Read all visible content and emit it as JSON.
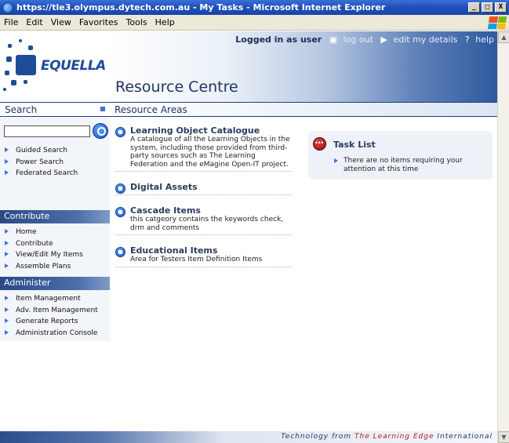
{
  "window": {
    "title": "https://tle3.olympus.dytech.com.au - My Tasks - Microsoft Internet Explorer",
    "buttons": {
      "minimize": "_",
      "maximize": "□",
      "close": "X"
    }
  },
  "menubar": {
    "items": [
      "File",
      "Edit",
      "View",
      "Favorites",
      "Tools",
      "Help"
    ]
  },
  "header": {
    "logo_text": "EQUELLA",
    "login_status": "Logged in as user",
    "logout": "log out",
    "edit_details": "edit my details",
    "help": "help",
    "site_title": "Resource Centre"
  },
  "sections": {
    "left": "Search",
    "right": "Resource Areas"
  },
  "sidebar": {
    "search": {
      "value": "",
      "placeholder": ""
    },
    "search_links": [
      "Guided Search",
      "Power Search",
      "Federated Search"
    ],
    "contribute_heading": "Contribute",
    "contribute_links": [
      "Home",
      "Contribute",
      "View/Edit My Items",
      "Assemble Plans"
    ],
    "administer_heading": "Administer",
    "administer_links": [
      "Item Management",
      "Adv. Item Management",
      "Generate Reports",
      "Administration Console"
    ]
  },
  "resource_areas": [
    {
      "title": "Learning Object Catalogue",
      "description": "A catalogue of all the Learning Objects in the system, including those provided from third-party sources such as The Learning Federation and the eMagine Open-IT project."
    },
    {
      "title": "Digital Assets",
      "description": ""
    },
    {
      "title": "Cascade Items",
      "description": "this catgeory contains the keywords check, drm and comments"
    },
    {
      "title": "Educational Items",
      "description": "Area for Testers Item Definition Items"
    }
  ],
  "task_list": {
    "title": "Task List",
    "message": "There are no items requiring your attention at this time"
  },
  "footer": {
    "prefix": "Technology from",
    "brand": "The Learning Edge",
    "suffix": "International"
  },
  "colors": {
    "title_bar": "#1f4fb8",
    "header_dark": "#2f5a9e",
    "nav_blue": "#3d78d4",
    "task_red": "#b02020"
  }
}
